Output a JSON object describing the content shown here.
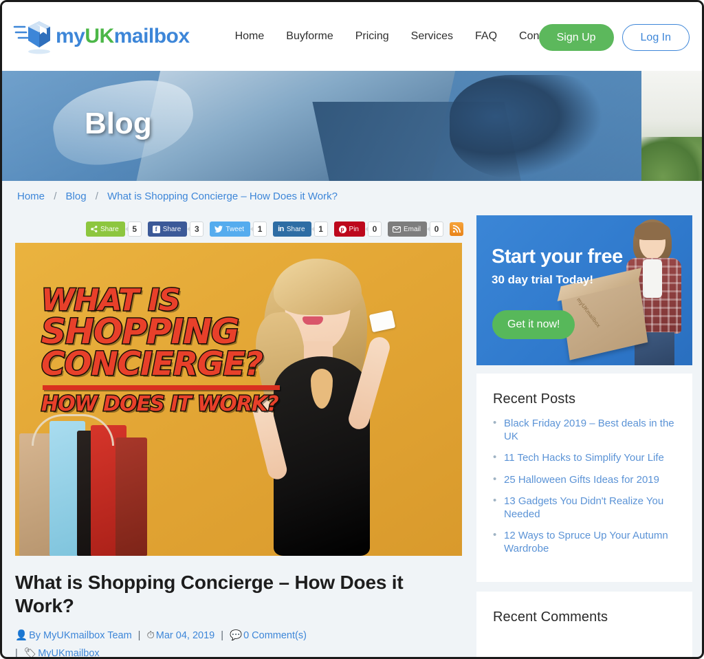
{
  "header": {
    "logo": {
      "part1": "my",
      "part2": "UK",
      "part3": "mailbox",
      "icon": "package-box-icon"
    },
    "nav": [
      {
        "label": "Home"
      },
      {
        "label": "Buyforme"
      },
      {
        "label": "Pricing"
      },
      {
        "label": "Services"
      },
      {
        "label": "FAQ"
      },
      {
        "label": "Contact"
      }
    ],
    "signup_label": "Sign Up",
    "login_label": "Log In",
    "colors": {
      "green": "#5cb85c",
      "blue": "#3d86d8"
    }
  },
  "hero": {
    "title": "Blog"
  },
  "breadcrumb": {
    "items": [
      {
        "label": "Home"
      },
      {
        "label": "Blog"
      },
      {
        "label": "What is Shopping Concierge – How Does it Work?"
      }
    ],
    "separator": "/"
  },
  "share_bar": {
    "buttons": [
      {
        "network": "generic",
        "label": "Share",
        "count": "5",
        "color": "#8dc63f"
      },
      {
        "network": "facebook",
        "label": "Share",
        "count": "3",
        "color": "#3b5998"
      },
      {
        "network": "twitter",
        "label": "Tweet",
        "count": "1",
        "color": "#55acee"
      },
      {
        "network": "linkedin",
        "label": "Share",
        "count": "1",
        "color": "#2e6da4"
      },
      {
        "network": "pinterest",
        "label": "Pin",
        "count": "0",
        "color": "#bd081c"
      },
      {
        "network": "email",
        "label": "Email",
        "count": "0",
        "color": "#7d7d7d"
      }
    ],
    "rss": {
      "name": "rss-icon",
      "color": "#ee8e27"
    }
  },
  "article": {
    "featured_image": {
      "line1": "WHAT IS",
      "line2": "SHOPPING",
      "line3": "CONCIERGE?",
      "line4": "HOW DOES IT WORK?",
      "background_color": "#e3a635",
      "text_color": "#e8402a"
    },
    "title": "What is Shopping Concierge – How Does it Work?",
    "meta": {
      "author": "By MyUKmailbox Team",
      "date": "Mar 04, 2019",
      "comments": "0 Comment(s)",
      "tag": "MyUKmailbox",
      "separator": "|",
      "icons": {
        "author": "user-icon",
        "date": "clock-icon",
        "comments": "comment-icon",
        "tag": "tag-icon"
      }
    }
  },
  "sidebar": {
    "ad": {
      "headline": "Start your free",
      "subheadline": "30 day trial Today!",
      "cta_label": "Get it now!",
      "box_logo": "myUKmailbox",
      "background_color": "#2f79cc",
      "cta_color": "#57b85a"
    },
    "recent_posts": {
      "title": "Recent Posts",
      "items": [
        {
          "label": "Black Friday 2019 – Best deals in the UK"
        },
        {
          "label": "11 Tech Hacks to Simplify Your Life"
        },
        {
          "label": "25 Halloween Gifts Ideas for 2019"
        },
        {
          "label": "13 Gadgets You Didn't Realize You Needed"
        },
        {
          "label": "12 Ways to Spruce Up Your Autumn Wardrobe"
        }
      ]
    },
    "recent_comments": {
      "title": "Recent Comments"
    }
  }
}
